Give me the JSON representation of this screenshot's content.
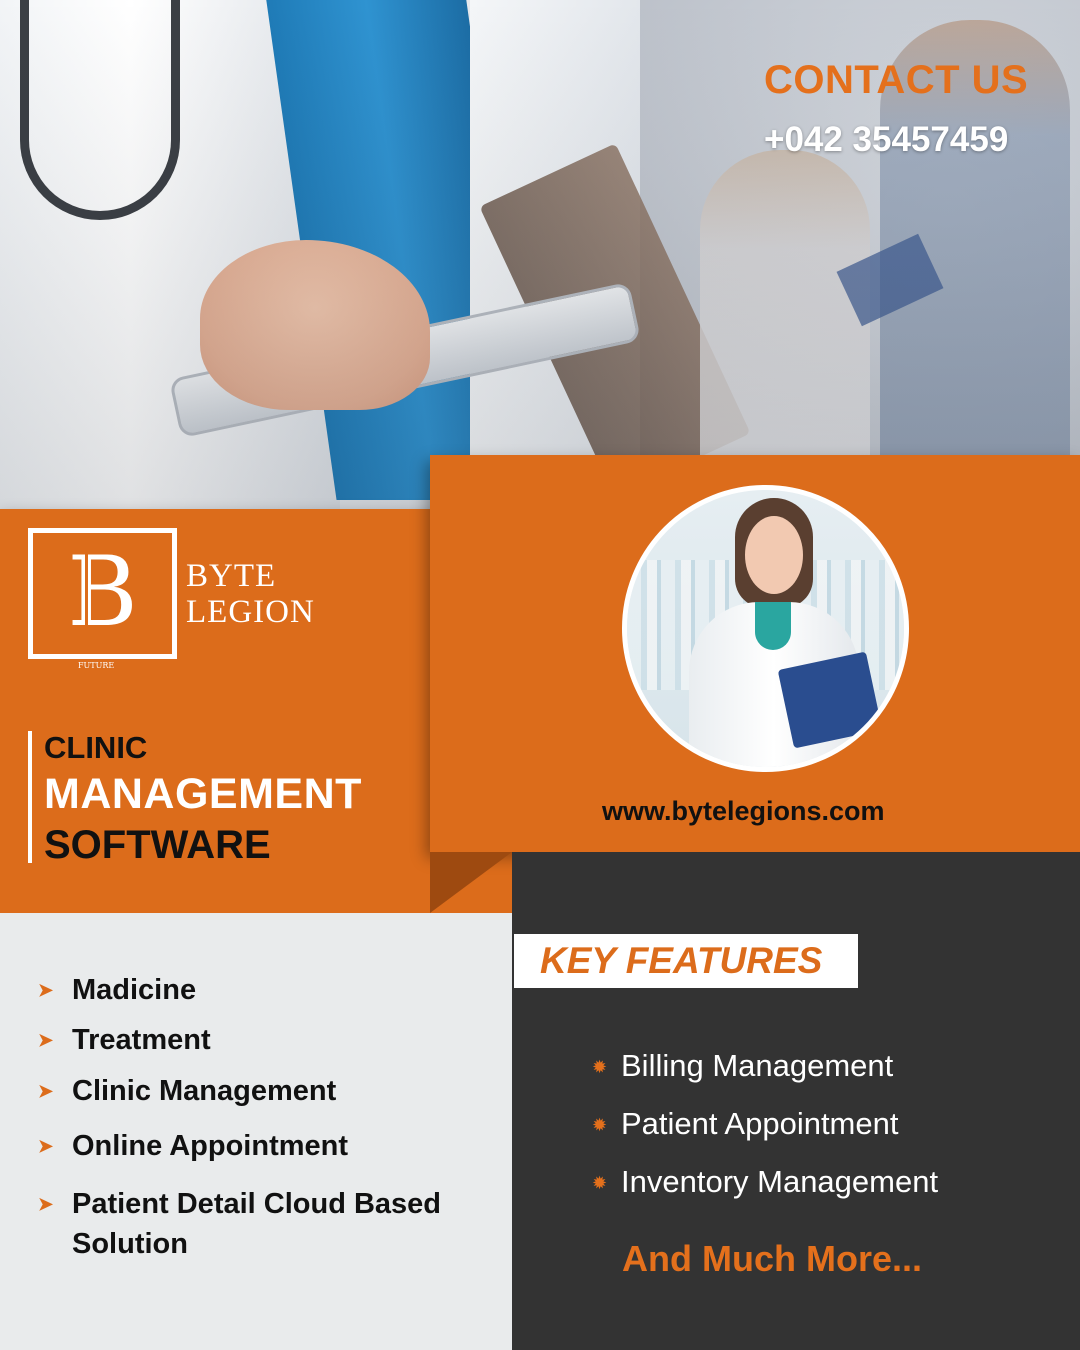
{
  "contact": {
    "title": "CONTACT US",
    "phone": "+042 35457459"
  },
  "brand": {
    "logo_letter": "B",
    "logo_tagline": "FUTURE",
    "name_line1": "BYTE",
    "name_line2": "LEGION"
  },
  "product": {
    "line1": "CLINIC",
    "line2": "MANAGEMENT",
    "line3": "SOFTWARE"
  },
  "website": "www.bytelegions.com",
  "key_features": {
    "heading": "KEY FEATURES",
    "items": [
      "Billing Management",
      "Patient Appointment",
      "Inventory Management"
    ],
    "more": "And Much More..."
  },
  "services": {
    "items": [
      "Madicine",
      "Treatment",
      "Clinic Management",
      "Online Appointment",
      "Patient Detail Cloud Based Solution"
    ],
    "bullet_icon": "arrow-right-icon"
  },
  "colors": {
    "accent_orange": "#dc6c1b",
    "dark_panel": "#333333",
    "light_panel": "#e9ebec"
  },
  "images": {
    "hero": "doctor-holding-tablet-photo",
    "portrait": "smiling-female-doctor-photo"
  }
}
